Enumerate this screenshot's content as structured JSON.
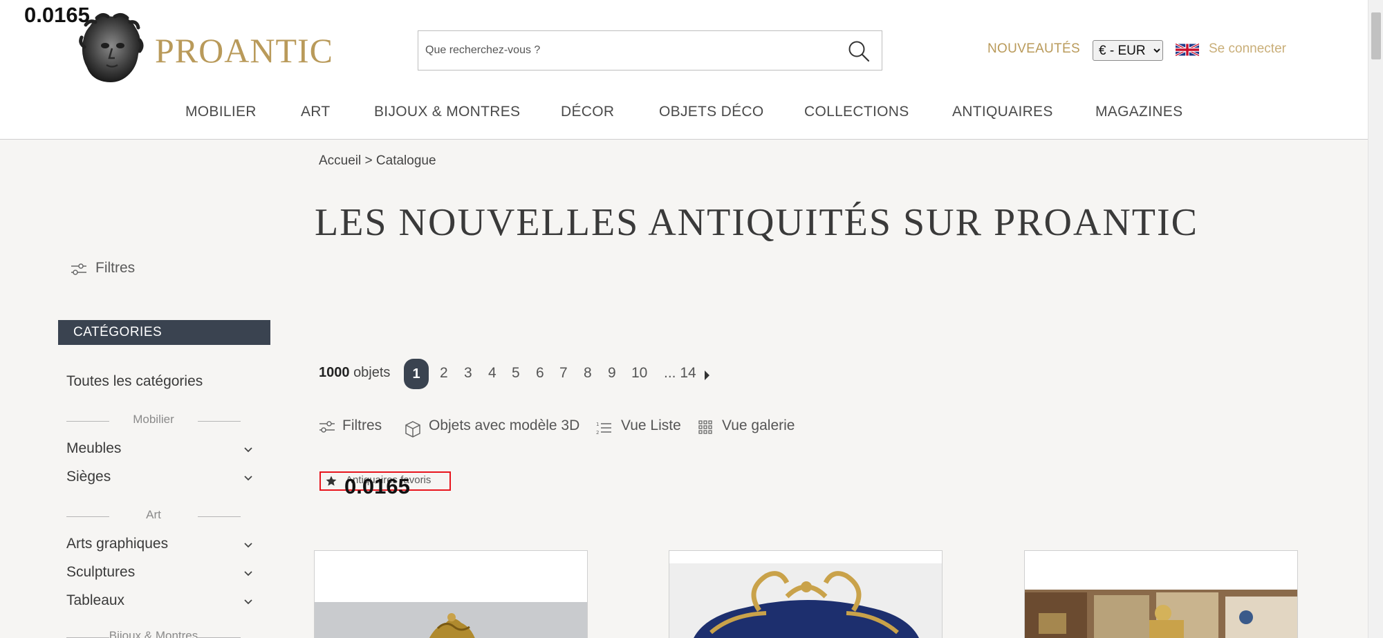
{
  "overlay": {
    "top_label": "0.0165",
    "mid_label": "0.0165"
  },
  "header": {
    "logo_text": "PROANTIC",
    "search_placeholder": "Que recherchez-vous ?",
    "nouveautes": "NOUVEAUTÉS",
    "currency": {
      "selected": "€ - EUR",
      "options": [
        "€ - EUR"
      ]
    },
    "login": "Se connecter"
  },
  "nav": {
    "items": [
      {
        "label": "MOBILIER"
      },
      {
        "label": "ART"
      },
      {
        "label": "BIJOUX & MONTRES"
      },
      {
        "label": "DÉCOR"
      },
      {
        "label": "OBJETS DÉCO"
      },
      {
        "label": "COLLECTIONS"
      },
      {
        "label": "ANTIQUAIRES"
      },
      {
        "label": "MAGAZINES"
      }
    ]
  },
  "breadcrumb": {
    "home": "Accueil",
    "sep": ">",
    "current": "Catalogue"
  },
  "page_title": "LES NOUVELLES ANTIQUITÉS SUR PROANTIC",
  "sidebar": {
    "filters": "Filtres",
    "categories_header": "CATÉGORIES",
    "all_categories": "Toutes les catégories",
    "sections": [
      {
        "title": "Mobilier",
        "items": [
          {
            "label": "Meubles"
          },
          {
            "label": "Sièges"
          }
        ]
      },
      {
        "title": "Art",
        "items": [
          {
            "label": "Arts graphiques"
          },
          {
            "label": "Sculptures"
          },
          {
            "label": "Tableaux"
          }
        ]
      },
      {
        "title": "Bijoux & Montres",
        "items": []
      }
    ]
  },
  "listing": {
    "count_number": "1000",
    "count_label": "objets",
    "pages": [
      "1",
      "2",
      "3",
      "4",
      "5",
      "6",
      "7",
      "8",
      "9",
      "10"
    ],
    "ellipsis_last": "... 14",
    "current_page": "1"
  },
  "toolbar": {
    "filters": "Filtres",
    "objects_3d": "Objets avec modèle 3D",
    "list_view": "Vue Liste",
    "gallery_view": "Vue galerie"
  },
  "favorites": {
    "label": "Antiquaires favoris"
  },
  "colors": {
    "brand_gold": "#b99a5a",
    "dark_slate": "#3a4350",
    "page_bg": "#f6f5f3",
    "highlight_red": "#e8141c"
  }
}
